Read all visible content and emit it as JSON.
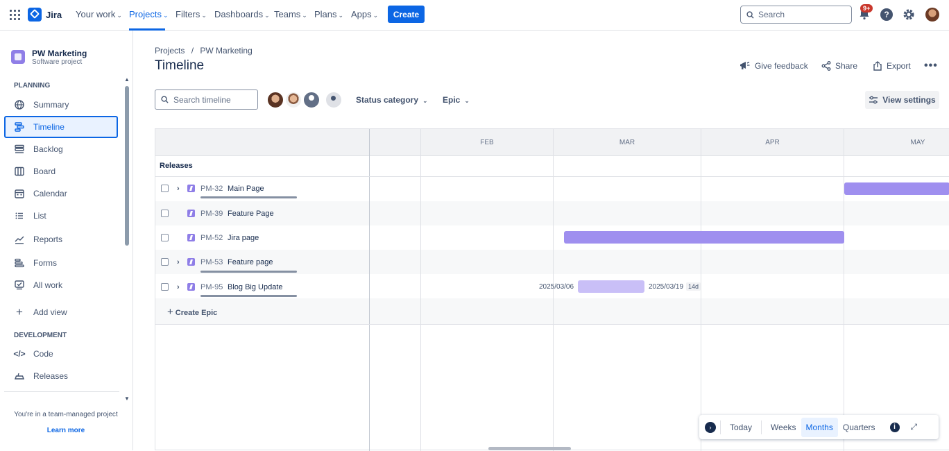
{
  "nav": {
    "app_name": "Jira",
    "items": [
      {
        "label": "Your work"
      },
      {
        "label": "Projects"
      },
      {
        "label": "Filters"
      },
      {
        "label": "Dashboards"
      },
      {
        "label": "Teams"
      },
      {
        "label": "Plans"
      },
      {
        "label": "Apps"
      }
    ],
    "create_label": "Create",
    "search_placeholder": "Search",
    "notifications_badge": "9+",
    "accent_color": "#0c66e4"
  },
  "sidebar": {
    "project_name": "PW Marketing",
    "project_type": "Software project",
    "planning_heading": "PLANNING",
    "planning_items": [
      {
        "label": "Summary",
        "icon": "globe-icon"
      },
      {
        "label": "Timeline",
        "icon": "timeline-icon",
        "active": true
      },
      {
        "label": "Backlog",
        "icon": "backlog-icon"
      },
      {
        "label": "Board",
        "icon": "board-icon"
      },
      {
        "label": "Calendar",
        "icon": "calendar-icon"
      },
      {
        "label": "List",
        "icon": "list-icon"
      },
      {
        "label": "Reports",
        "icon": "reports-icon"
      },
      {
        "label": "Forms",
        "icon": "forms-icon"
      },
      {
        "label": "All work",
        "icon": "all-work-icon"
      }
    ],
    "add_view_label": "Add view",
    "development_heading": "DEVELOPMENT",
    "development_items": [
      {
        "label": "Code",
        "icon": "code-icon"
      },
      {
        "label": "Releases",
        "icon": "releases-icon"
      }
    ],
    "footer_text": "You're in a team-managed project",
    "footer_link": "Learn more"
  },
  "main": {
    "breadcrumb": {
      "root": "Projects",
      "separator": "/",
      "project": "PW Marketing"
    },
    "title": "Timeline",
    "actions": {
      "feedback": "Give feedback",
      "share": "Share",
      "export": "Export"
    },
    "search_placeholder": "Search timeline",
    "filters": {
      "status_category": "Status category",
      "epic": "Epic"
    },
    "view_settings": "View settings"
  },
  "timeline": {
    "months": [
      "FEB",
      "MAR",
      "APR",
      "MAY"
    ],
    "releases_label": "Releases",
    "epics": [
      {
        "key": "PM-32",
        "title": "Main Page",
        "expandable": true
      },
      {
        "key": "PM-39",
        "title": "Feature Page",
        "expandable": false
      },
      {
        "key": "PM-52",
        "title": "Jira page",
        "expandable": false
      },
      {
        "key": "PM-53",
        "title": "Feature page",
        "expandable": true
      },
      {
        "key": "PM-95",
        "title": "Blog Big Update",
        "expandable": true
      }
    ],
    "blog_update_start": "2025/03/06",
    "blog_update_end": "2025/03/19",
    "blog_update_duration": "14d",
    "create_epic_label": "Create Epic",
    "bar_color": "#9f8fef"
  },
  "zoom": {
    "today": "Today",
    "weeks": "Weeks",
    "months": "Months",
    "quarters": "Quarters",
    "active": "Months"
  }
}
